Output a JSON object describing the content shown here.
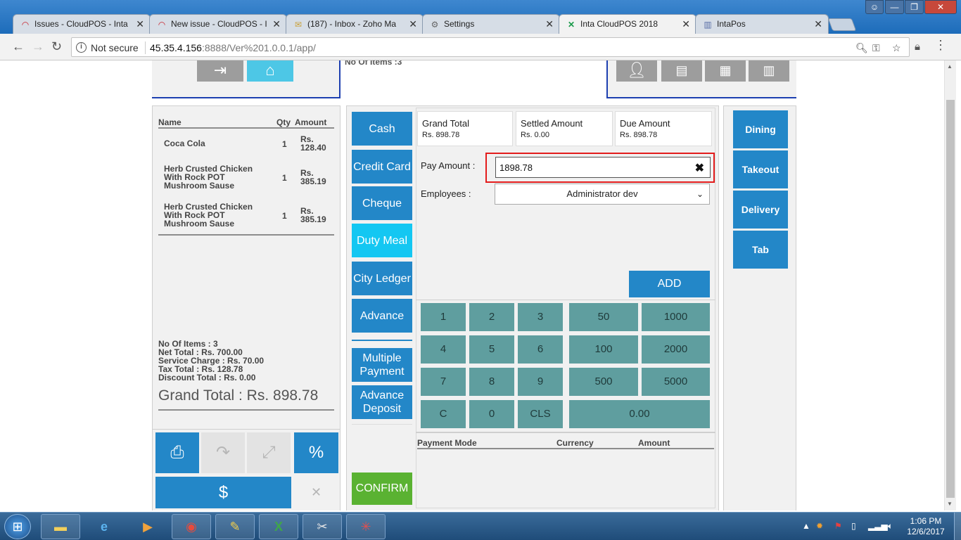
{
  "browser": {
    "tabs": [
      {
        "label": "Issues - CloudPOS - Inta",
        "favicon": "redmine-icon"
      },
      {
        "label": "New issue - CloudPOS - I",
        "favicon": "redmine-icon"
      },
      {
        "label": "(187) - Inbox - Zoho Ma",
        "favicon": "mail-icon"
      },
      {
        "label": "Settings",
        "favicon": "gear-icon"
      },
      {
        "label": "Inta CloudPOS 2018",
        "favicon": "intapos-icon"
      },
      {
        "label": "IntaPos",
        "favicon": "chart-icon"
      }
    ],
    "security_label": "Not secure",
    "url_host": "45.35.4.156",
    "url_rest": ":8888/Ver%201.0.0.1/app/"
  },
  "top": {
    "items_count_text": "No Of Items :3"
  },
  "order": {
    "headers": {
      "name": "Name",
      "qty": "Qty",
      "amount": "Amount"
    },
    "items": [
      {
        "name": "Coca Cola",
        "qty": "1",
        "amount": "Rs. 128.40"
      },
      {
        "name": "Herb Crusted Chicken With Rock POT Mushroom Sause",
        "qty": "1",
        "amount": "Rs. 385.19"
      },
      {
        "name": "Herb Crusted Chicken With Rock POT Mushroom Sause",
        "qty": "1",
        "amount": "Rs. 385.19"
      }
    ],
    "summary": {
      "items": "No Of Items : 3",
      "net": "Net Total : Rs. 700.00",
      "service": "Service Charge : Rs. 70.00",
      "tax": "Tax Total : Rs. 128.78",
      "discount": "Discount Total : Rs. 0.00"
    },
    "grand_total": "Grand Total : Rs. 898.78",
    "tools": {
      "percent": "%",
      "dollar": "$"
    }
  },
  "payment": {
    "modes": [
      "Cash",
      "Credit Card",
      "Cheque",
      "Duty Meal",
      "City Ledger",
      "Advance"
    ],
    "extra_modes": [
      "Multiple Payment",
      "Advance Deposit"
    ],
    "confirm": "CONFIRM",
    "info": [
      {
        "label": "Grand Total",
        "value": "Rs. 898.78"
      },
      {
        "label": "Settled Amount",
        "value": "Rs. 0.00"
      },
      {
        "label": "Due Amount",
        "value": "Rs. 898.78"
      }
    ],
    "pay_amount_label": "Pay Amount :",
    "pay_amount_value": "1898.78",
    "employees_label": "Employees :",
    "employee_selected": "Administrator dev",
    "add_label": "ADD",
    "keypad": {
      "rows": [
        [
          "1",
          "2",
          "3",
          "50",
          "1000"
        ],
        [
          "4",
          "5",
          "6",
          "100",
          "2000"
        ],
        [
          "7",
          "8",
          "9",
          "500",
          "5000"
        ],
        [
          "C",
          "0",
          "CLS",
          "0.00"
        ]
      ]
    },
    "table_headers": {
      "mode": "Payment Mode",
      "currency": "Currency",
      "amount": "Amount"
    }
  },
  "order_types": [
    "Dining",
    "Takeout",
    "Delivery",
    "Tab"
  ],
  "taskbar": {
    "time": "1:06 PM",
    "date": "12/6/2017"
  },
  "colors": {
    "accent_blue": "#2387c8",
    "cyan": "#14c7f2",
    "confirm_green": "#5ab232",
    "keypad_teal": "#5f9e9f",
    "highlight_red": "#e31c1c"
  }
}
